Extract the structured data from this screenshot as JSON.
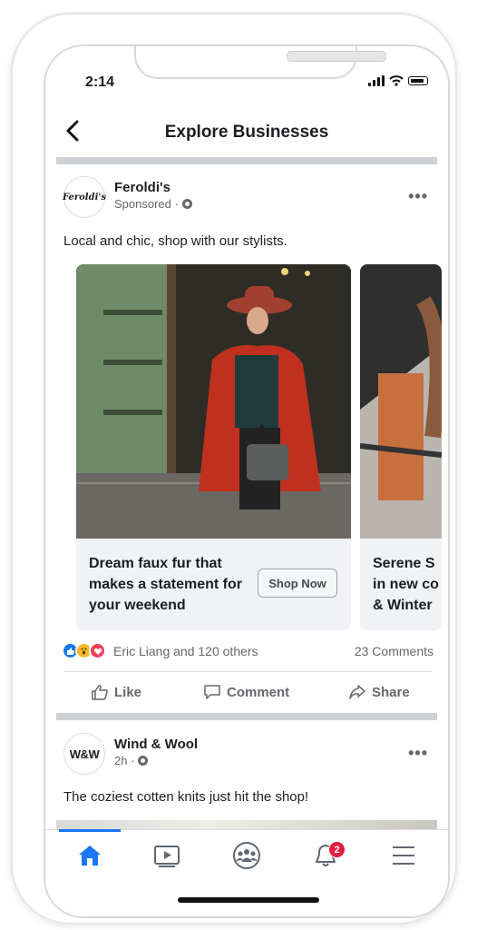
{
  "status_bar": {
    "time": "2:14"
  },
  "header": {
    "title": "Explore Businesses",
    "back_icon": "chevron-left-icon"
  },
  "post1": {
    "brand": "Feroldi's",
    "brand_logo_text": "Feroldi's",
    "meta": "Sponsored ·",
    "text": "Local and chic, shop with our stylists.",
    "cards": [
      {
        "title": "Dream faux fur that makes a statement for your weekend",
        "button": "Shop Now"
      },
      {
        "title": "Serene S\nin new co\n& Winter"
      }
    ],
    "reactions_text": "Eric Liang and 120 others",
    "comments": "23 Comments",
    "actions": {
      "like": "Like",
      "comment": "Comment",
      "share": "Share"
    }
  },
  "post2": {
    "brand": "Wind & Wool",
    "avatar_text": "W&W",
    "meta": "2h ·",
    "text": "The coziest cotten knits just hit the shop!"
  },
  "tabbar": {
    "items": [
      "home-icon",
      "video-icon",
      "groups-icon",
      "notifications-icon",
      "menu-icon"
    ],
    "notification_count": "2"
  },
  "colors": {
    "accent": "#1877f2",
    "badge": "#e41e3f",
    "separator": "#cdd0d4"
  }
}
